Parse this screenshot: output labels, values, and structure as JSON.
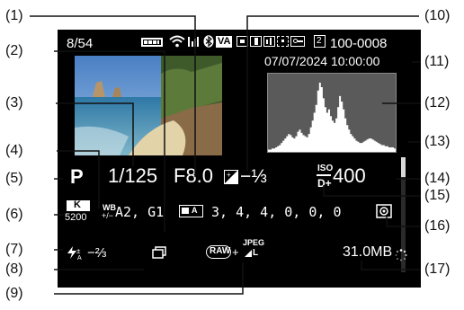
{
  "screen": {
    "image_counter": "8/54",
    "file_number": "100-0008",
    "folder_icon_digit": "2",
    "date_time": "07/07/2024 10:00:00",
    "shutter_speed": "1/125",
    "aperture": "F8.0",
    "exposure_comp": "−⅓",
    "mode": "P",
    "iso_label": "ISO",
    "iso_value": "400",
    "d_plus": "D+",
    "wb_label": "WB",
    "wb_shift": "A2, G1",
    "picture_style_values": "3, 4, 4, 0, 0, 0",
    "color_temp_label": "K",
    "color_temp_value": "5200",
    "flash_comp": "−⅔",
    "image_quality_raw": "RAW",
    "image_quality_jpeg": "JPEG",
    "image_quality_size": "L",
    "file_size": "31.0MB",
    "va_label": "VA"
  },
  "callouts": [
    {
      "label": "(1)"
    },
    {
      "label": "(2)"
    },
    {
      "label": "(3)"
    },
    {
      "label": "(4)"
    },
    {
      "label": "(5)"
    },
    {
      "label": "(6)"
    },
    {
      "label": "(7)"
    },
    {
      "label": "(8)"
    },
    {
      "label": "(9)"
    },
    {
      "label": "(10)"
    },
    {
      "label": "(11)"
    },
    {
      "label": "(12)"
    },
    {
      "label": "(13)"
    },
    {
      "label": "(14)"
    },
    {
      "label": "(15)"
    },
    {
      "label": "(16)"
    },
    {
      "label": "(17)"
    }
  ],
  "histogram": {
    "color": "#ffffff",
    "background": "#5a5a5a",
    "levels": [
      2,
      2,
      3,
      3,
      4,
      5,
      6,
      8,
      10,
      12,
      14,
      16,
      15,
      13,
      12,
      14,
      18,
      20,
      17,
      15,
      14,
      13,
      16,
      22,
      28,
      35,
      42,
      55,
      62,
      58,
      48,
      40,
      35,
      38,
      32,
      28,
      26,
      30,
      40,
      50,
      45,
      38,
      30,
      24,
      20,
      16,
      14,
      12,
      10,
      9,
      8,
      8,
      9,
      10,
      11,
      12,
      12,
      11,
      10,
      9,
      8,
      7,
      6,
      6,
      5,
      5,
      4,
      4,
      4,
      3
    ]
  },
  "icons": {
    "battery": "battery-icon",
    "wifi": "wifi-icon",
    "signal": "signal-icon",
    "bluetooth": "bluetooth-icon",
    "protect": "protect-icon",
    "rating": "rating-icon",
    "audio": "audio-icon",
    "metering": "metering-icon",
    "drive": "drive-mode-icon"
  }
}
